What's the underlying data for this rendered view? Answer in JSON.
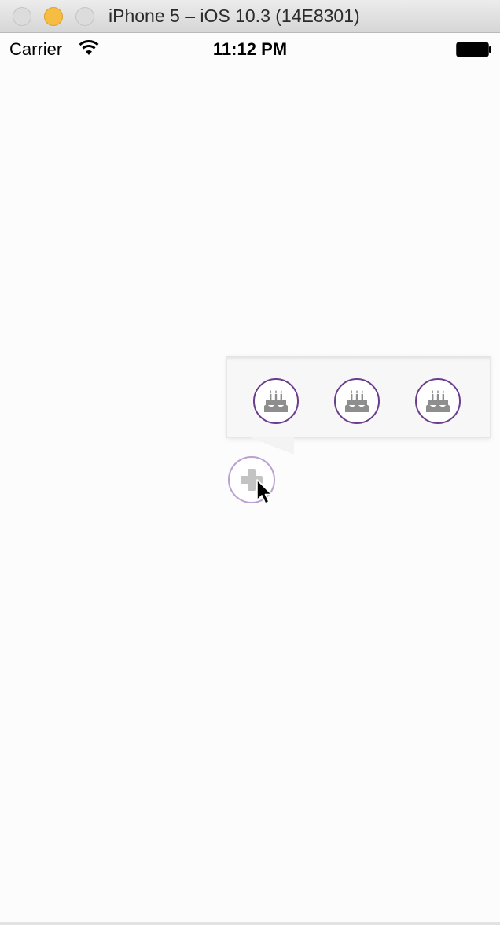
{
  "window": {
    "title": "iPhone 5 – iOS 10.3 (14E8301)",
    "buttons": {
      "close": "close-icon",
      "minimize": "minimize-icon",
      "zoom": "zoom-icon"
    }
  },
  "status_bar": {
    "carrier": "Carrier",
    "time": "11:12 PM",
    "icons": [
      "wifi-icon",
      "battery-icon"
    ]
  },
  "menu": {
    "items": [
      {
        "icon": "birthday-cake-icon"
      },
      {
        "icon": "birthday-cake-icon"
      },
      {
        "icon": "birthday-cake-icon"
      }
    ],
    "accent_color": "#6a3d8f"
  },
  "fab": {
    "icon": "plus-icon",
    "border_color": "#b9a1d3"
  }
}
